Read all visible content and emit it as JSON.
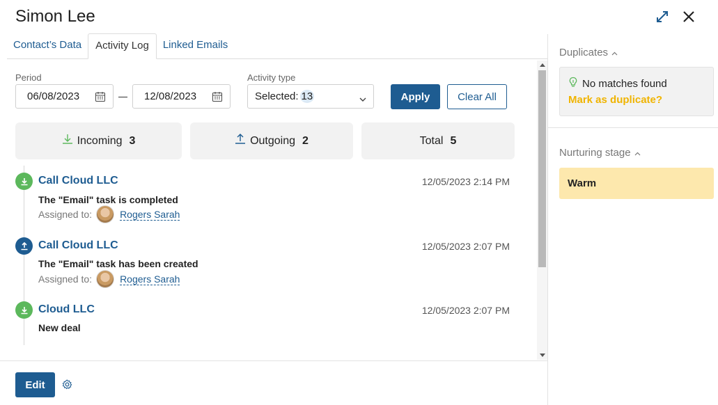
{
  "header": {
    "title": "Simon Lee",
    "expand_icon": "expand-arrows-icon",
    "close_icon": "close-icon"
  },
  "tabs": [
    {
      "label": "Contact’s Data",
      "active": false
    },
    {
      "label": "Activity Log",
      "active": true
    },
    {
      "label": "Linked Emails",
      "active": false
    }
  ],
  "filters": {
    "period_label": "Period",
    "date_from": "06/08/2023",
    "date_to": "12/08/2023",
    "activity_type_label": "Activity type",
    "activity_type_value": "Selected:",
    "activity_type_count": "13",
    "apply_label": "Apply",
    "clear_label": "Clear All"
  },
  "stats": {
    "incoming_label": "Incoming",
    "incoming_count": "3",
    "outgoing_label": "Outgoing",
    "outgoing_count": "2",
    "total_label": "Total",
    "total_count": "5"
  },
  "entries": [
    {
      "direction": "incoming",
      "title": "Call Cloud LLC",
      "time": "12/05/2023 2:14 PM",
      "description": "The \"Email\" task is completed",
      "assigned_label": "Assigned to:",
      "assignee": "Rogers Sarah"
    },
    {
      "direction": "outgoing",
      "title": "Call Cloud LLC",
      "time": "12/05/2023 2:07 PM",
      "description": "The \"Email\" task has been created",
      "assigned_label": "Assigned to:",
      "assignee": "Rogers Sarah"
    },
    {
      "direction": "incoming",
      "title": "Cloud LLC",
      "time": "12/05/2023 2:07 PM",
      "description": "New deal"
    }
  ],
  "footer": {
    "edit_label": "Edit"
  },
  "sidebar": {
    "duplicates_label": "Duplicates",
    "no_matches": "No matches found",
    "mark_duplicate": "Mark as duplicate?",
    "nurturing_label": "Nurturing stage",
    "stage_value": "Warm"
  },
  "colors": {
    "accent": "#1e5c91",
    "incoming": "#5cb85c",
    "outgoing": "#1e5c91",
    "warning": "#f0b400",
    "stage_bg": "#fde8ad"
  }
}
